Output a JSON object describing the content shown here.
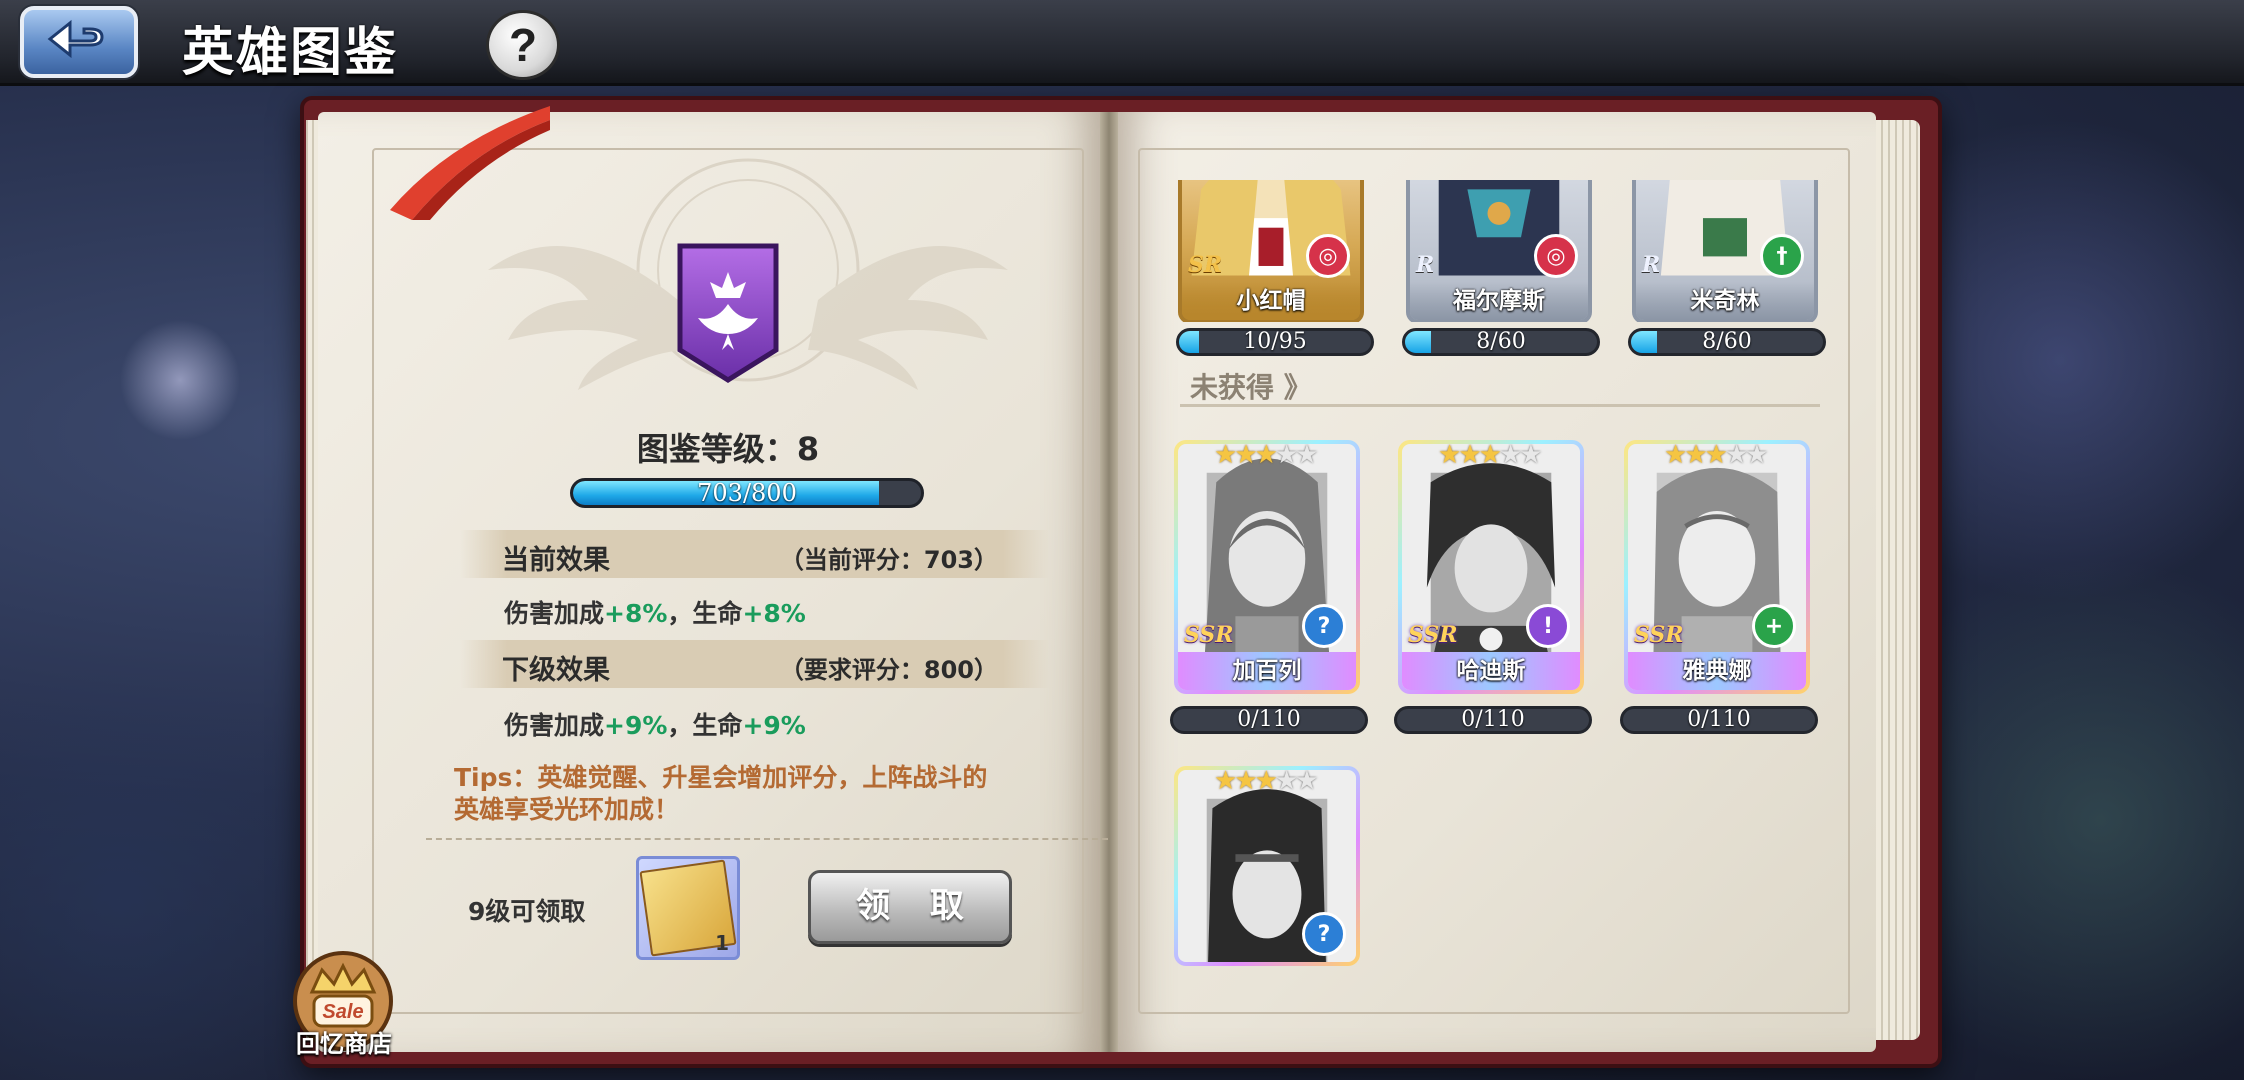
{
  "header": {
    "title": "英雄图鉴",
    "help_label": "?"
  },
  "collection": {
    "level_label": "图鉴等级：8",
    "progress_text": "703/800",
    "progress_fraction": 0.879
  },
  "current_effect": {
    "title": "当前效果",
    "score": "（当前评分：703）",
    "line_prefix": "伤害加成",
    "damage": "+8%",
    "sep": "，生命",
    "hp": "+8%"
  },
  "next_effect": {
    "title": "下级效果",
    "score": "（要求评分：800）",
    "line_prefix": "伤害加成",
    "damage": "+9%",
    "sep": "，生命",
    "hp": "+9%"
  },
  "tips": {
    "line1": "Tips：英雄觉醒、升星会增加评分，上阵战斗的",
    "line2": "英雄享受光环加成！"
  },
  "reward": {
    "label": "9级可领取",
    "count": "1",
    "claim_label": "领 取"
  },
  "shop": {
    "badge": "Sale",
    "label": "回忆商店"
  },
  "obtained_heroes": [
    {
      "name": "小红帽",
      "rarity": "SR",
      "progress": "10/95",
      "fill": 0.105,
      "class_color": "#d6324a"
    },
    {
      "name": "福尔摩斯",
      "rarity": "R",
      "progress": "8/60",
      "fill": 0.133,
      "class_color": "#d6324a"
    },
    {
      "name": "米奇林",
      "rarity": "R",
      "progress": "8/60",
      "fill": 0.133,
      "class_color": "#2aa34a"
    }
  ],
  "unobtained_section": {
    "title": "未获得 》"
  },
  "unobtained_heroes": [
    {
      "name": "加百列",
      "rarity": "SSR",
      "progress": "0/110",
      "stars": 3,
      "class_color": "#2c7fd6",
      "class_glyph": "?"
    },
    {
      "name": "哈迪斯",
      "rarity": "SSR",
      "progress": "0/110",
      "stars": 3,
      "class_color": "#8a4ad6",
      "class_glyph": "!"
    },
    {
      "name": "雅典娜",
      "rarity": "SSR",
      "progress": "0/110",
      "stars": 3,
      "class_color": "#2aa34a",
      "class_glyph": "+"
    },
    {
      "name": "",
      "rarity": "",
      "progress": "",
      "stars": 3,
      "class_color": "#2c7fd6",
      "class_glyph": "?"
    }
  ],
  "colors": {
    "accent_blue": "#1fa9e8",
    "bonus_green": "#1a9c5c",
    "tips_orange": "#b46a33",
    "book_red": "#6a1f25"
  }
}
